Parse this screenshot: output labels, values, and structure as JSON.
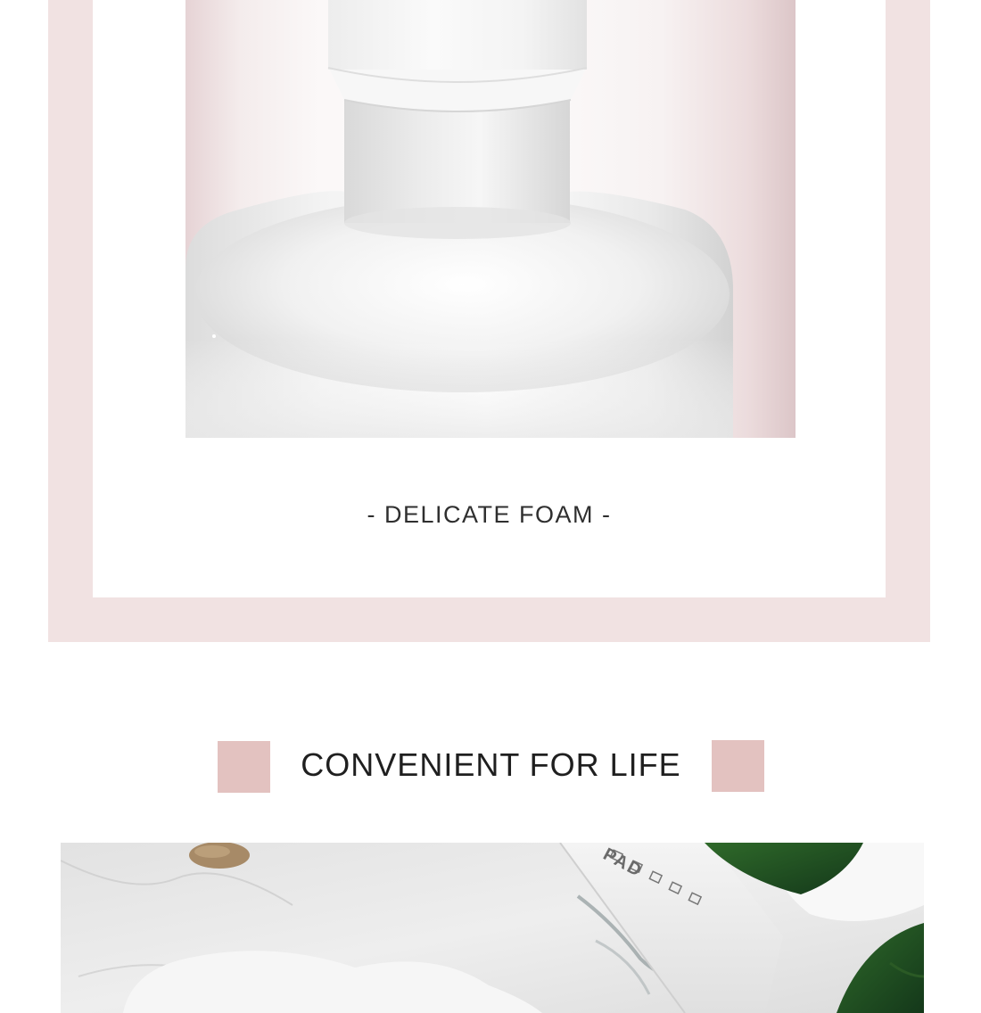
{
  "top_section": {
    "caption": "- DELICATE FOAM -",
    "frame_color": "#f1e2e2",
    "photo_subject": "white-foam-pump-bottle"
  },
  "convenience_section": {
    "heading": "CONVENIENT FOR LIFE",
    "accent_color": "#e3c2c0",
    "photo_subject": "marble-counter-lifestyle",
    "box_print": "PAD"
  }
}
